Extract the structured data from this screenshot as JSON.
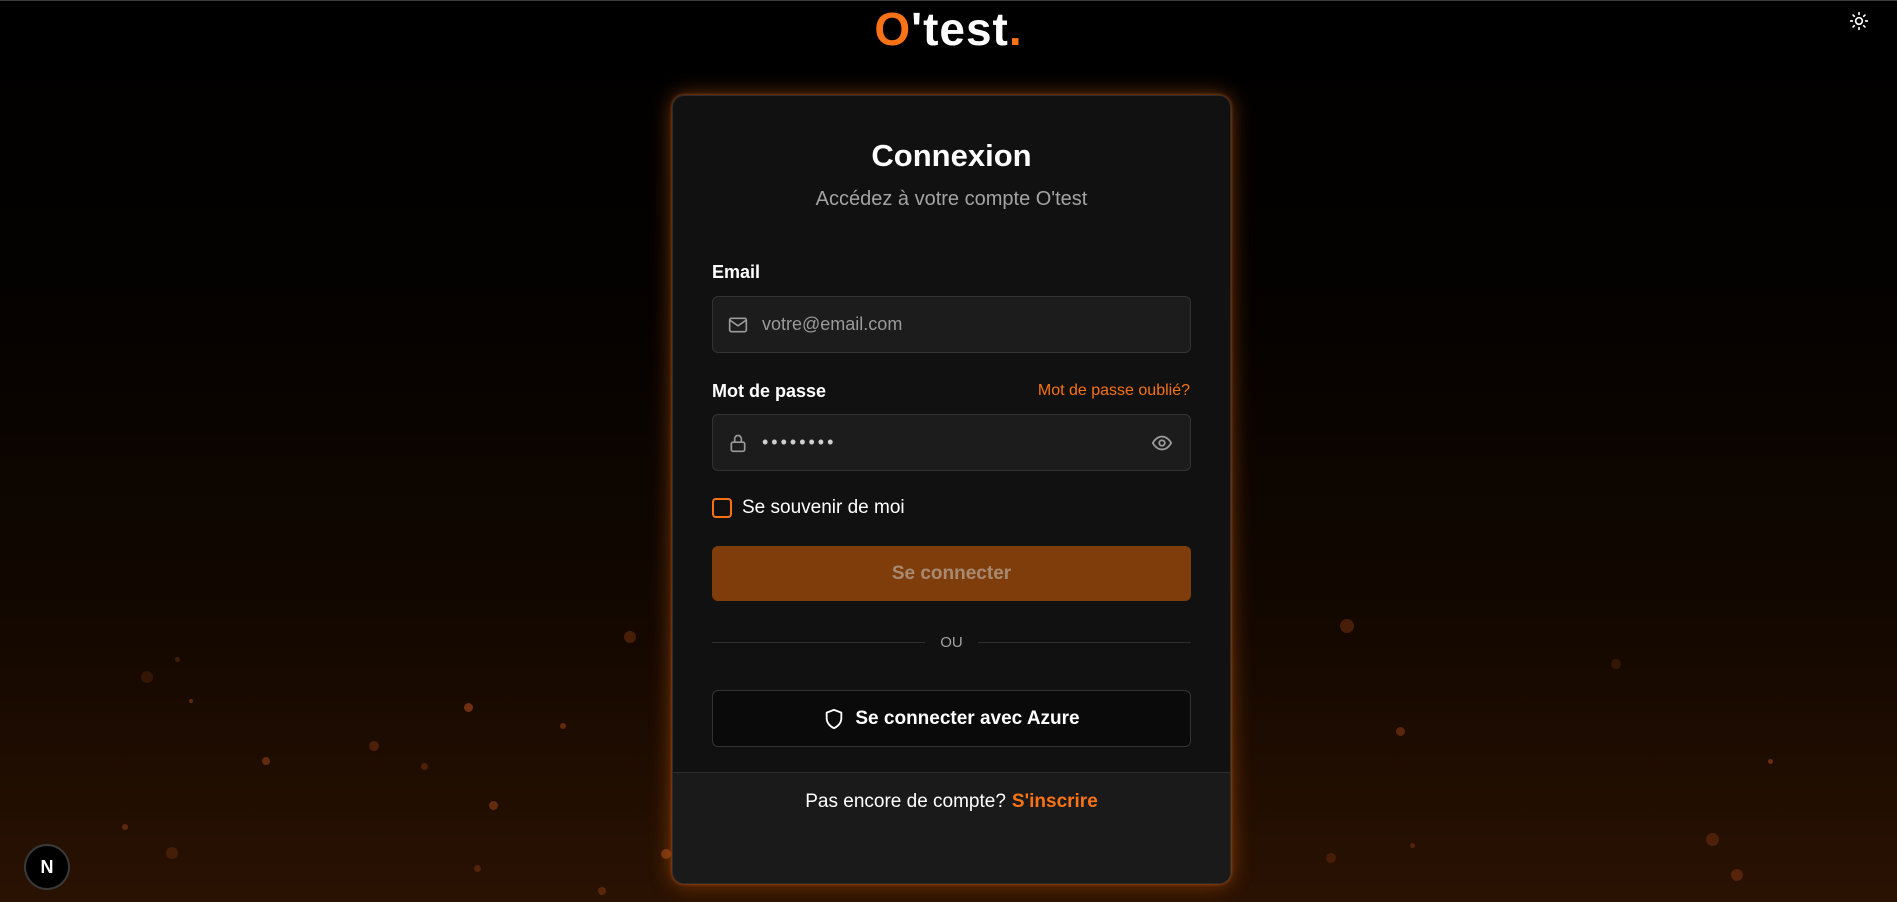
{
  "brand": {
    "logo_o": "O",
    "logo_rest": "'test",
    "logo_dot": "."
  },
  "header": {
    "theme_toggle_icon": "sun-icon"
  },
  "login": {
    "title": "Connexion",
    "subtitle": "Accédez à votre compte O'test",
    "email_label": "Email",
    "email_placeholder": "votre@email.com",
    "email_icon": "mail-icon",
    "password_label": "Mot de passe",
    "password_value": "••••••••",
    "password_icon": "lock-icon",
    "show_password_icon": "eye-icon",
    "forgot_password": "Mot de passe oublié?",
    "remember_me": "Se souvenir de moi",
    "submit_label": "Se connecter",
    "divider_text": "OU",
    "azure_label": "Se connecter avec Azure",
    "azure_icon": "shield-icon"
  },
  "footer": {
    "question": "Pas encore de compte?",
    "signup_link": "S'inscrire"
  },
  "dev_badge": {
    "label": "N"
  },
  "colors": {
    "accent": "#f97316",
    "card_bg": "#111111",
    "submit_bg": "#7f3d0c",
    "page_bg_top": "#000000",
    "page_bg_bottom": "#2a1202"
  }
}
